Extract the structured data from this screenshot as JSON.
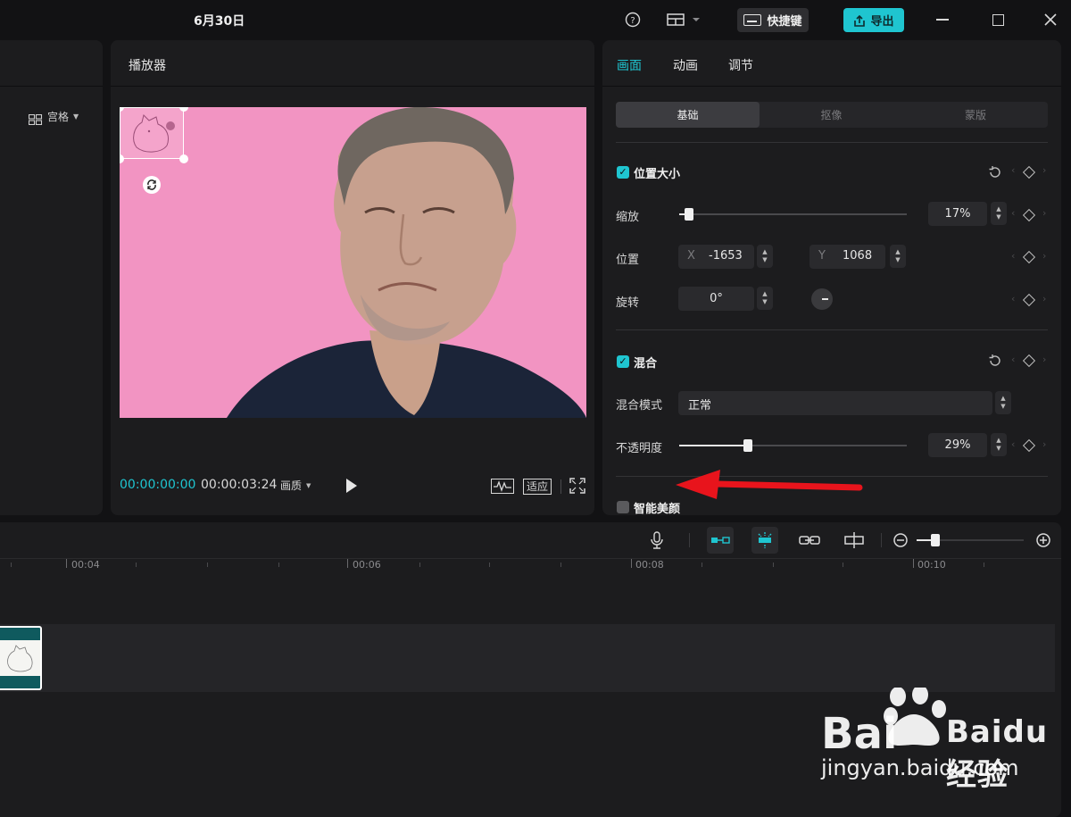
{
  "app": {
    "title": "6月30日"
  },
  "header": {
    "shortcut_label": "快捷键",
    "export_label": "导出"
  },
  "left_panel": {
    "layout_label": "宫格"
  },
  "player": {
    "title": "播放器",
    "time_current": "00:00:00:00",
    "time_total": "00:00:03:24",
    "quality_label": "画质",
    "fit_label": "适应"
  },
  "inspector": {
    "tabs": [
      {
        "label": "画面",
        "active": true
      },
      {
        "label": "动画",
        "active": false
      },
      {
        "label": "调节",
        "active": false
      }
    ],
    "subtabs": [
      {
        "label": "基础",
        "active": true
      },
      {
        "label": "抠像",
        "active": false
      },
      {
        "label": "蒙版",
        "active": false
      }
    ],
    "transform": {
      "section_label": "位置大小",
      "scale_label": "缩放",
      "scale_value": "17%",
      "scale_level": 0.03,
      "position_label": "位置",
      "x_label": "X",
      "x_value": "-1653",
      "y_label": "Y",
      "y_value": "1068",
      "rotate_label": "旋转",
      "rotate_value": "0°"
    },
    "blend": {
      "section_label": "混合",
      "mode_label": "混合模式",
      "mode_value": "正常",
      "opacity_label": "不透明度",
      "opacity_value": "29%",
      "opacity_level": 0.29
    },
    "beauty": {
      "section_label": "智能美颜"
    }
  },
  "timeline": {
    "ticks": [
      "00:04",
      "00:06",
      "00:08",
      "00:10"
    ]
  },
  "watermark": {
    "brand": "Baidu经验",
    "url": "jingyan.baidu.com"
  },
  "colors": {
    "accent": "#1fc5d0",
    "video_bg": "#f294c2",
    "arrow": "#e8141c"
  }
}
